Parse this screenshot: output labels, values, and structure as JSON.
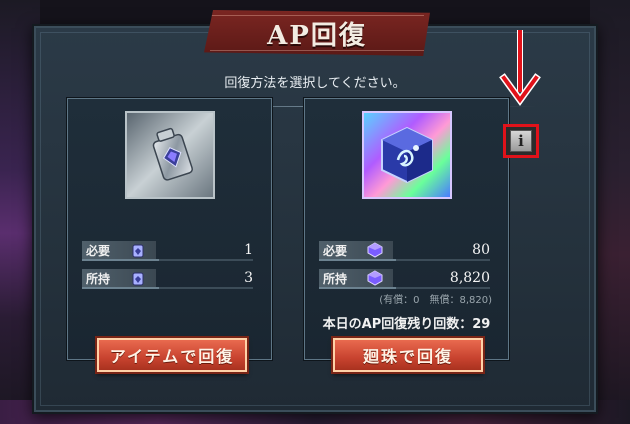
{
  "title": "AP回復",
  "subtitle": "回復方法を選択してください。",
  "left_card": {
    "required_label": "必要",
    "required_value": "1",
    "owned_label": "所持",
    "owned_value": "3",
    "button_label": "アイテムで回復"
  },
  "right_card": {
    "required_label": "必要",
    "required_value": "80",
    "owned_label": "所持",
    "owned_value": "8,820",
    "breakdown": "(有償：0　無償：8,820)",
    "remaining": "本日のAP回復残り回数：29",
    "button_label": "廻珠で回復"
  },
  "info_button": {
    "icon": "i"
  },
  "colors": {
    "annotation_red": "#e1121a",
    "button_orange": "#d2523a",
    "title_banner": "#6b1f1c"
  },
  "icons": {
    "item_left": "ap-recovery-potion-icon",
    "item_right": "crystal-cube-icon",
    "gem": "purple-gem-icon",
    "arrow": "red-down-arrow"
  }
}
